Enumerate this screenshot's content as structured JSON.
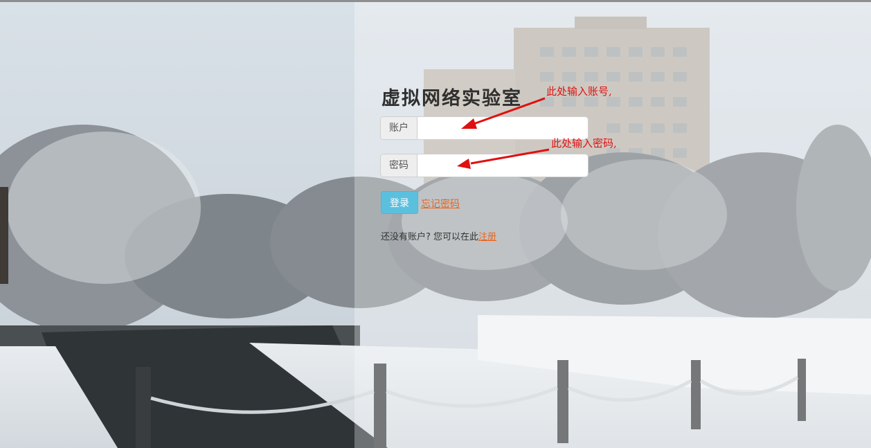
{
  "page": {
    "title": "虚拟网络实验室"
  },
  "login_form": {
    "account_label": "账户",
    "account_value": "",
    "password_label": "密码",
    "password_value": "",
    "login_button": "登录",
    "forgot_password_link": "忘记密码",
    "register_prompt": "还没有账户? 您可以在此",
    "register_link": "注册"
  },
  "annotations": {
    "account_hint": "此处输入账号,",
    "password_hint": "此处输入密码,"
  },
  "colors": {
    "login_button": "#5bc0de",
    "link": "#e8651f",
    "annotation": "#e01010"
  }
}
